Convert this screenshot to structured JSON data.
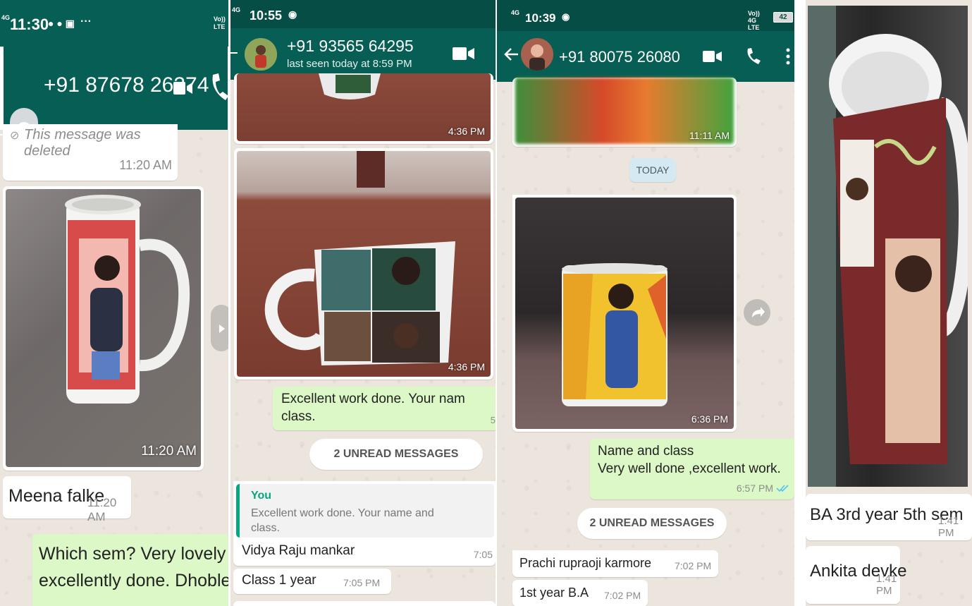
{
  "panel1": {
    "status_time": "11:30",
    "status_net": "4G",
    "status_right": "Vo)) LTE",
    "status_more": "···",
    "contact": "+91 87678 26374",
    "deleted_text": "This message was deleted",
    "deleted_time": "11:20 AM",
    "photo_time": "11:20 AM",
    "name_msg": "Meena falke",
    "name_time": "11:20 AM",
    "out_msg_line1": "Which sem? Very lovely work,",
    "out_msg_line2": "excellently done. Dhoble madam"
  },
  "panel2": {
    "status_time": "10:55",
    "status_net": "4G",
    "contact": "+91 93565 64295",
    "last_seen": "last seen today at 8:59 PM",
    "photo1_time": "4:36 PM",
    "photo2_time": "4:36 PM",
    "out_msg_line1": "Excellent work done. Your nam",
    "out_msg_line2": "class.",
    "out_msg_time": "5",
    "unread": "2 UNREAD MESSAGES",
    "reply_author": "You",
    "reply_quote_line1": "Excellent work done. Your name and",
    "reply_quote_line2": "class.",
    "reply_text": "Vidya Raju mankar",
    "reply_time": "7:05",
    "msg2": "Class 1 year",
    "msg2_time": "7:05 PM"
  },
  "panel3": {
    "status_time": "10:39",
    "status_net": "4G",
    "status_right": "Vo)) 4G LTE",
    "battery": "42",
    "contact": "+91 80075 26080",
    "photo1_time": "11:11 AM",
    "today": "TODAY",
    "photo2_time": "6:36 PM",
    "out_msg_line1": "Name and class",
    "out_msg_line2": "Very well done ,excellent work.",
    "out_msg_time": "6:57 PM",
    "tick_color": "#4fc3f7",
    "unread": "2 UNREAD MESSAGES",
    "msg1": "Prachi rupraoji karmore",
    "msg1_time": "7:02 PM",
    "msg2": "1st year B.A",
    "msg2_time": "7:02 PM"
  },
  "panel4": {
    "msg1": "BA 3rd year 5th sem",
    "msg1_time": "1:41 PM",
    "msg2": "Ankita devke",
    "msg2_time": "1:41 PM"
  },
  "colors": {
    "header": "#075e54",
    "outgoing": "#dcf8c6",
    "wallpaper": "#ece5dd",
    "reply_bar": "#06a77d"
  }
}
